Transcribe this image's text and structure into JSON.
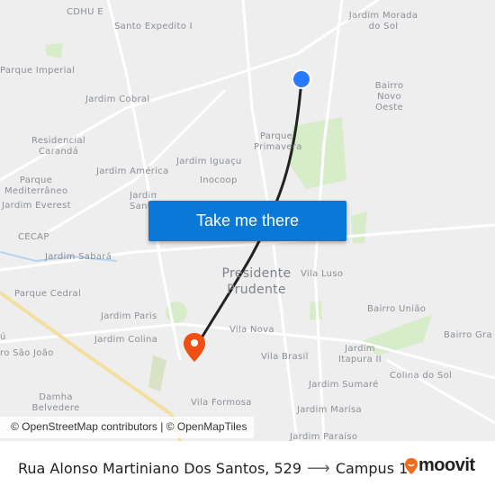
{
  "map": {
    "labels": [
      "CDHU E",
      "Santo Expedito I",
      "Jardim Morada do Sol",
      "Parque Imperial",
      "Bairro Novo Oeste",
      "Jardim Cobral",
      "Parque Primavera",
      "Residencial Carandá",
      "Jardim Iguaçu",
      "Jardim América",
      "Inocoop",
      "Parque Mediterrâneo",
      "Jardim Santo",
      "Jardim Everest",
      "CECAP",
      "Jardim Sabará",
      "Vila Luso",
      "Parque Cedral",
      "Bairro União",
      "Jardim Paris",
      "Vila Nova",
      "Bairro Gra",
      "Jardim Colina",
      "ú",
      "ro São João",
      "Vila Brasil",
      "Jardim Itapura II",
      "Colina do Sol",
      "Jardim Sumaré",
      "Damha Belvedere",
      "Vila Formosa",
      "Jardim Marisa",
      "Jardim Paraíso"
    ],
    "city_label": "Presidente Prudente",
    "origin_marker_color": "#2979ff",
    "destination_marker_color": "#f04e12",
    "route_color": "#222222"
  },
  "cta_label": "Take me there",
  "attribution": "© OpenStreetMap contributors | © OpenMapTiles",
  "footer": {
    "origin": "Rua Alonso Martiniano Dos Santos, 529",
    "arrow_icon": "arrow-right-icon",
    "destination": "Campus 1",
    "brand": "moovit",
    "brand_color": "#f26a1b"
  }
}
